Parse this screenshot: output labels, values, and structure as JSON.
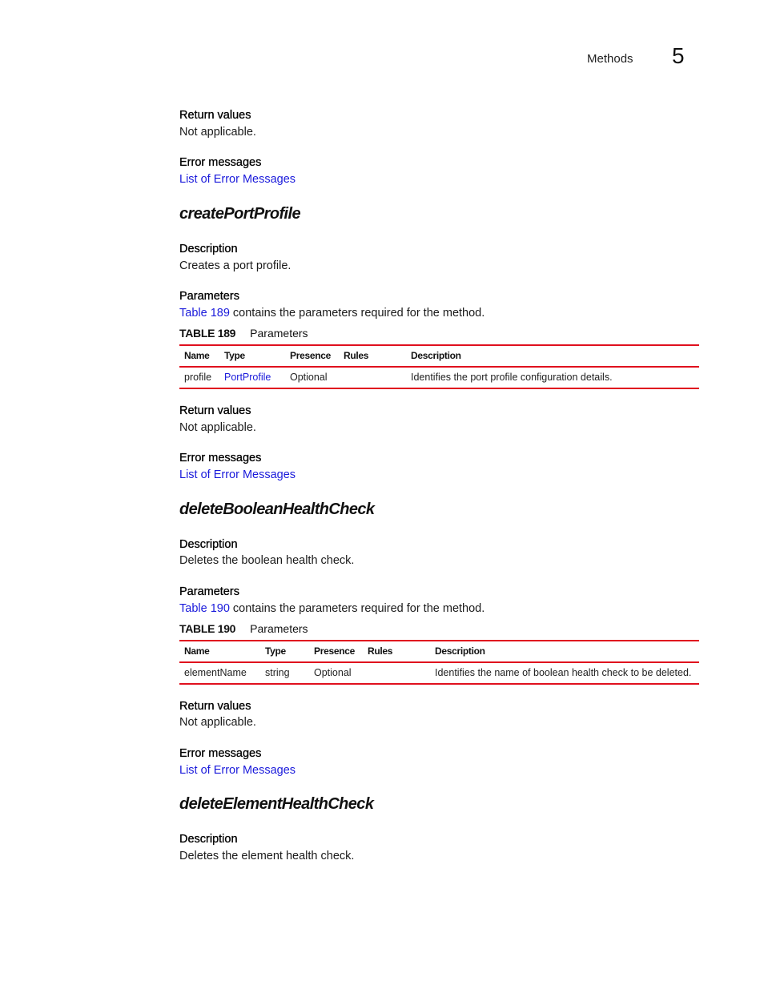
{
  "header": {
    "section": "Methods",
    "chapter": "5"
  },
  "intro": {
    "return_values_heading": "Return values",
    "return_values_text": "Not applicable.",
    "error_messages_heading": "Error messages",
    "error_messages_link": "List of Error Messages"
  },
  "methods": [
    {
      "name": "createPortProfile",
      "description_heading": "Description",
      "description": "Creates a port profile.",
      "parameters_heading": "Parameters",
      "parameters_link": "Table 189",
      "parameters_text": " contains the parameters required for the method.",
      "table_label": "TABLE 189",
      "table_caption": "Parameters",
      "columns": [
        "Name",
        "Type",
        "Presence",
        "Rules",
        "Description"
      ],
      "rows": [
        {
          "name": "profile",
          "type": "PortProfile",
          "presence": "Optional",
          "rules": "",
          "description": "Identifies the port profile configuration details."
        }
      ],
      "return_values_heading": "Return values",
      "return_values_text": "Not applicable.",
      "error_messages_heading": "Error messages",
      "error_messages_link": "List of Error Messages"
    },
    {
      "name": "deleteBooleanHealthCheck",
      "description_heading": "Description",
      "description": "Deletes the boolean health check.",
      "parameters_heading": "Parameters",
      "parameters_link": "Table 190",
      "parameters_text": " contains the parameters required for the method.",
      "table_label": "TABLE 190",
      "table_caption": "Parameters",
      "columns": [
        "Name",
        "Type",
        "Presence",
        "Rules",
        "Description"
      ],
      "rows": [
        {
          "name": "elementName",
          "type": "string",
          "presence": "Optional",
          "rules": "",
          "description": "Identifies the name of boolean health check to be deleted."
        }
      ],
      "return_values_heading": "Return values",
      "return_values_text": "Not applicable.",
      "error_messages_heading": "Error messages",
      "error_messages_link": "List of Error Messages"
    },
    {
      "name": "deleteElementHealthCheck",
      "description_heading": "Description",
      "description": "Deletes the element health check."
    }
  ]
}
